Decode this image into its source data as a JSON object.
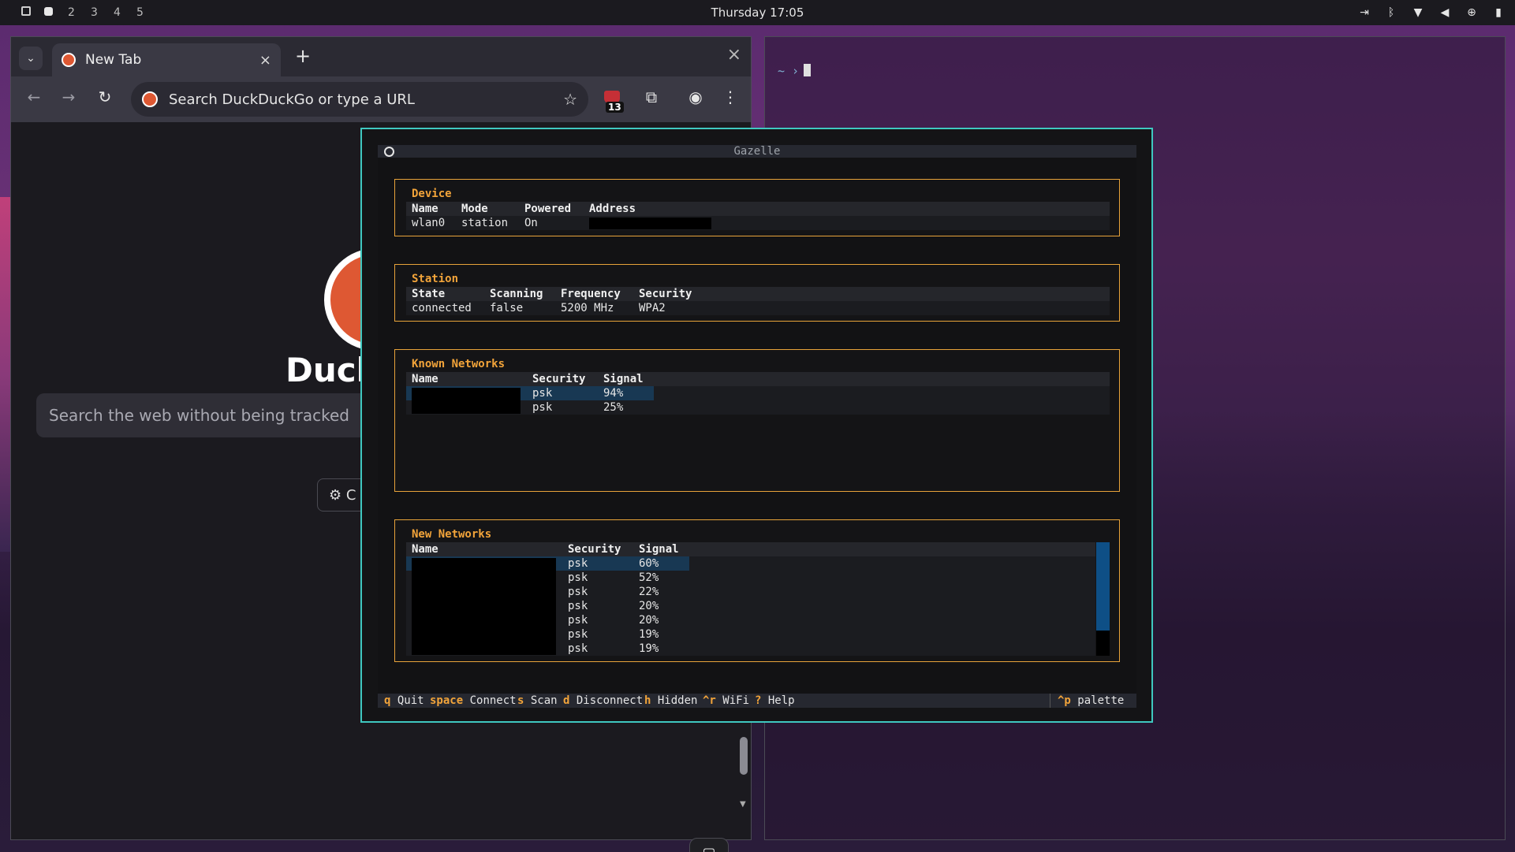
{
  "topbar": {
    "workspaces": [
      "2",
      "3",
      "4",
      "5"
    ],
    "clock": "Thursday 17:05",
    "tray_icons": [
      "logout-icon",
      "bluetooth-icon",
      "wifi-icon",
      "volume-icon",
      "vpn-icon",
      "battery-icon"
    ]
  },
  "browser": {
    "tab": {
      "title": "New Tab",
      "close": "×"
    },
    "new_tab": "+",
    "window_close": "×",
    "omnibox_placeholder": "Search DuckDuckGo or type a URL",
    "extension_badge": "13",
    "page": {
      "brand": "DuckD",
      "search_placeholder": "Search the web without being tracked",
      "settings_button": "C"
    }
  },
  "terminal": {
    "prompt": "~ ›"
  },
  "gazelle": {
    "title": "Gazelle",
    "device": {
      "title": "Device",
      "headers": [
        "Name",
        "Mode",
        "Powered",
        "Address"
      ],
      "row": [
        "wlan0",
        "station",
        "On",
        ""
      ]
    },
    "station": {
      "title": "Station",
      "headers": [
        "State",
        "Scanning",
        "Frequency",
        "Security"
      ],
      "row": [
        "connected",
        "false",
        "5200 MHz",
        "WPA2"
      ]
    },
    "known_networks": {
      "title": "Known Networks",
      "headers": [
        "Name",
        "Security",
        "Signal"
      ],
      "rows": [
        {
          "security": "psk",
          "signal": "94%"
        },
        {
          "security": "psk",
          "signal": "25%"
        }
      ]
    },
    "new_networks": {
      "title": "New Networks",
      "headers": [
        "Name",
        "Security",
        "Signal"
      ],
      "rows": [
        {
          "security": "psk",
          "signal": "60%"
        },
        {
          "security": "psk",
          "signal": "52%"
        },
        {
          "security": "psk",
          "signal": "22%"
        },
        {
          "security": "psk",
          "signal": "20%"
        },
        {
          "security": "psk",
          "signal": "20%"
        },
        {
          "security": "psk",
          "signal": "19%"
        },
        {
          "security": "psk",
          "signal": "19%"
        }
      ]
    },
    "footer": {
      "keys": [
        {
          "key": "q",
          "label": "Quit"
        },
        {
          "key": "space",
          "label": "Connect"
        },
        {
          "key": "s",
          "label": "Scan"
        },
        {
          "key": "d",
          "label": "Disconnect"
        },
        {
          "key": "h",
          "label": "Hidden"
        },
        {
          "key": "^r",
          "label": "WiFi"
        },
        {
          "key": "?",
          "label": "Help"
        }
      ],
      "palette_key": "^p",
      "palette_label": "palette"
    }
  },
  "colors": {
    "accent_border": "#3fc8c0",
    "panel_border": "#e8a33a",
    "key_color": "#f2a43a",
    "selection": "#183853"
  }
}
